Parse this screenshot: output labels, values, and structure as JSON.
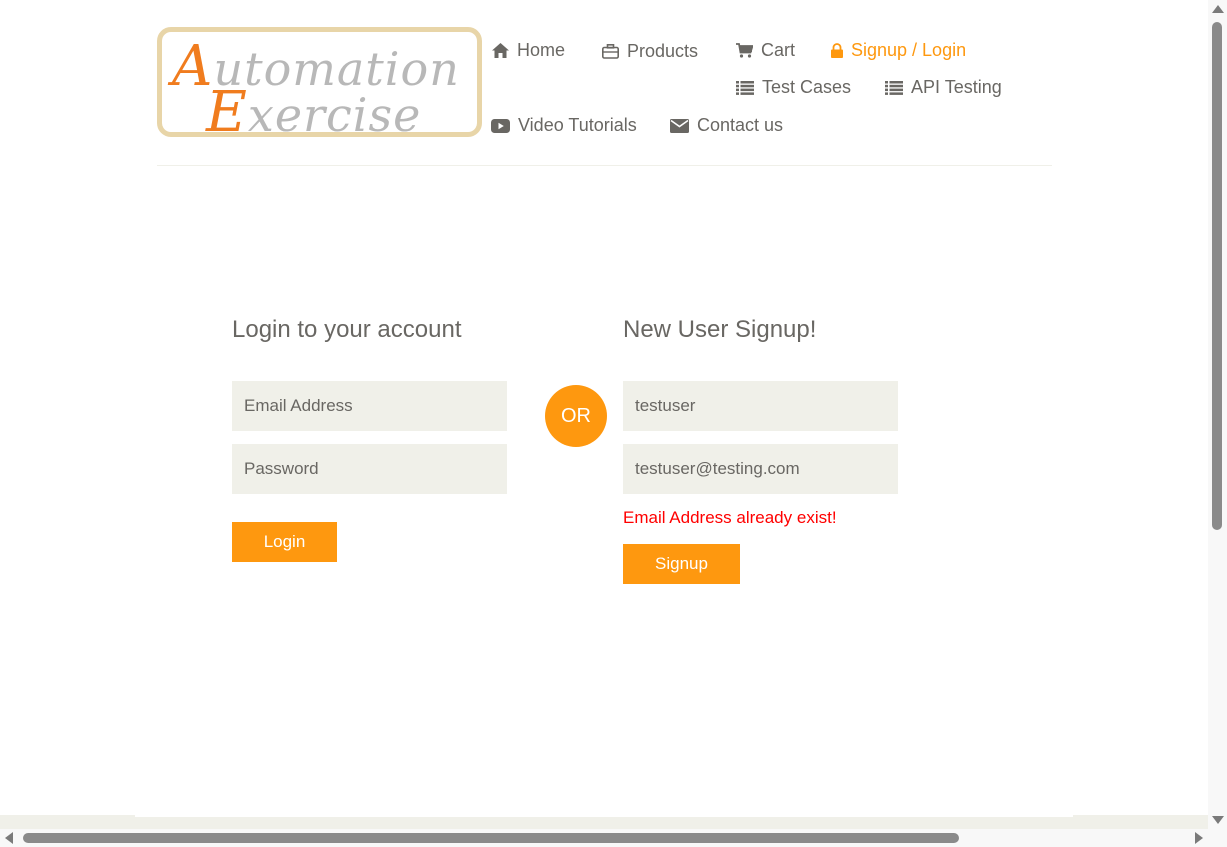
{
  "header": {
    "logo": {
      "line1_cap": "A",
      "line1_rest": "utomation",
      "line2_cap": "E",
      "line2_rest": "xercise"
    },
    "nav": [
      {
        "label": "Home",
        "icon": "home-icon"
      },
      {
        "label": "Products",
        "icon": "briefcase-icon"
      },
      {
        "label": "Cart",
        "icon": "cart-icon"
      },
      {
        "label": "Signup / Login",
        "icon": "lock-icon",
        "active": true
      },
      {
        "label": "Test Cases",
        "icon": "list-icon"
      },
      {
        "label": "API Testing",
        "icon": "list-icon"
      },
      {
        "label": "Video Tutorials",
        "icon": "youtube-icon"
      },
      {
        "label": "Contact us",
        "icon": "envelope-icon"
      }
    ]
  },
  "login": {
    "title": "Login to your account",
    "email_placeholder": "Email Address",
    "password_placeholder": "Password",
    "button": "Login"
  },
  "divider": {
    "label": "OR"
  },
  "signup": {
    "title": "New User Signup!",
    "name_value": "testuser",
    "email_value": "testuser@testing.com",
    "error": "Email Address already exist!",
    "button": "Signup"
  },
  "colors": {
    "accent": "#fe980f",
    "text": "#696763",
    "field_bg": "#f0f0e9",
    "error": "#ff0000"
  }
}
